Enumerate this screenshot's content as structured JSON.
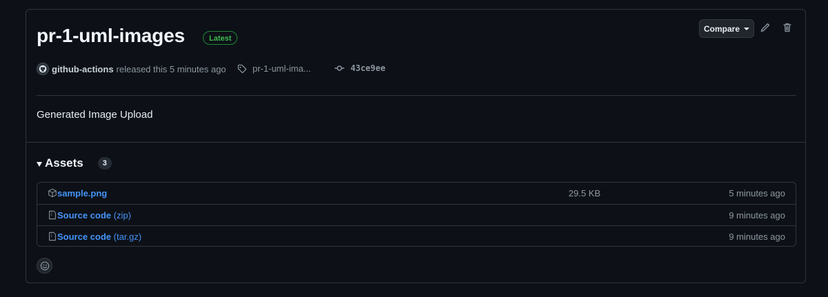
{
  "release": {
    "title": "pr-1-uml-images",
    "badge": "Latest",
    "author": "github-actions",
    "released_text": "released this 5 minutes ago",
    "tag": "pr-1-uml-ima...",
    "commit": "43ce9ee",
    "body": "Generated Image Upload",
    "compare_label": "Compare"
  },
  "assets": {
    "title": "Assets",
    "count": "3",
    "rows": [
      {
        "name": "sample.png",
        "ext": "",
        "size": "29.5 KB",
        "time": "5 minutes ago",
        "icon": "package-icon"
      },
      {
        "name": "Source code",
        "ext": " (zip)",
        "size": "",
        "time": "9 minutes ago",
        "icon": "file-zip-icon"
      },
      {
        "name": "Source code",
        "ext": " (tar.gz)",
        "size": "",
        "time": "9 minutes ago",
        "icon": "file-zip-icon"
      }
    ]
  },
  "colors": {
    "background": "#0d1117",
    "border": "#30363d",
    "link": "#4493f8",
    "badge_green": "#3fb950",
    "muted": "#8d96a0"
  }
}
